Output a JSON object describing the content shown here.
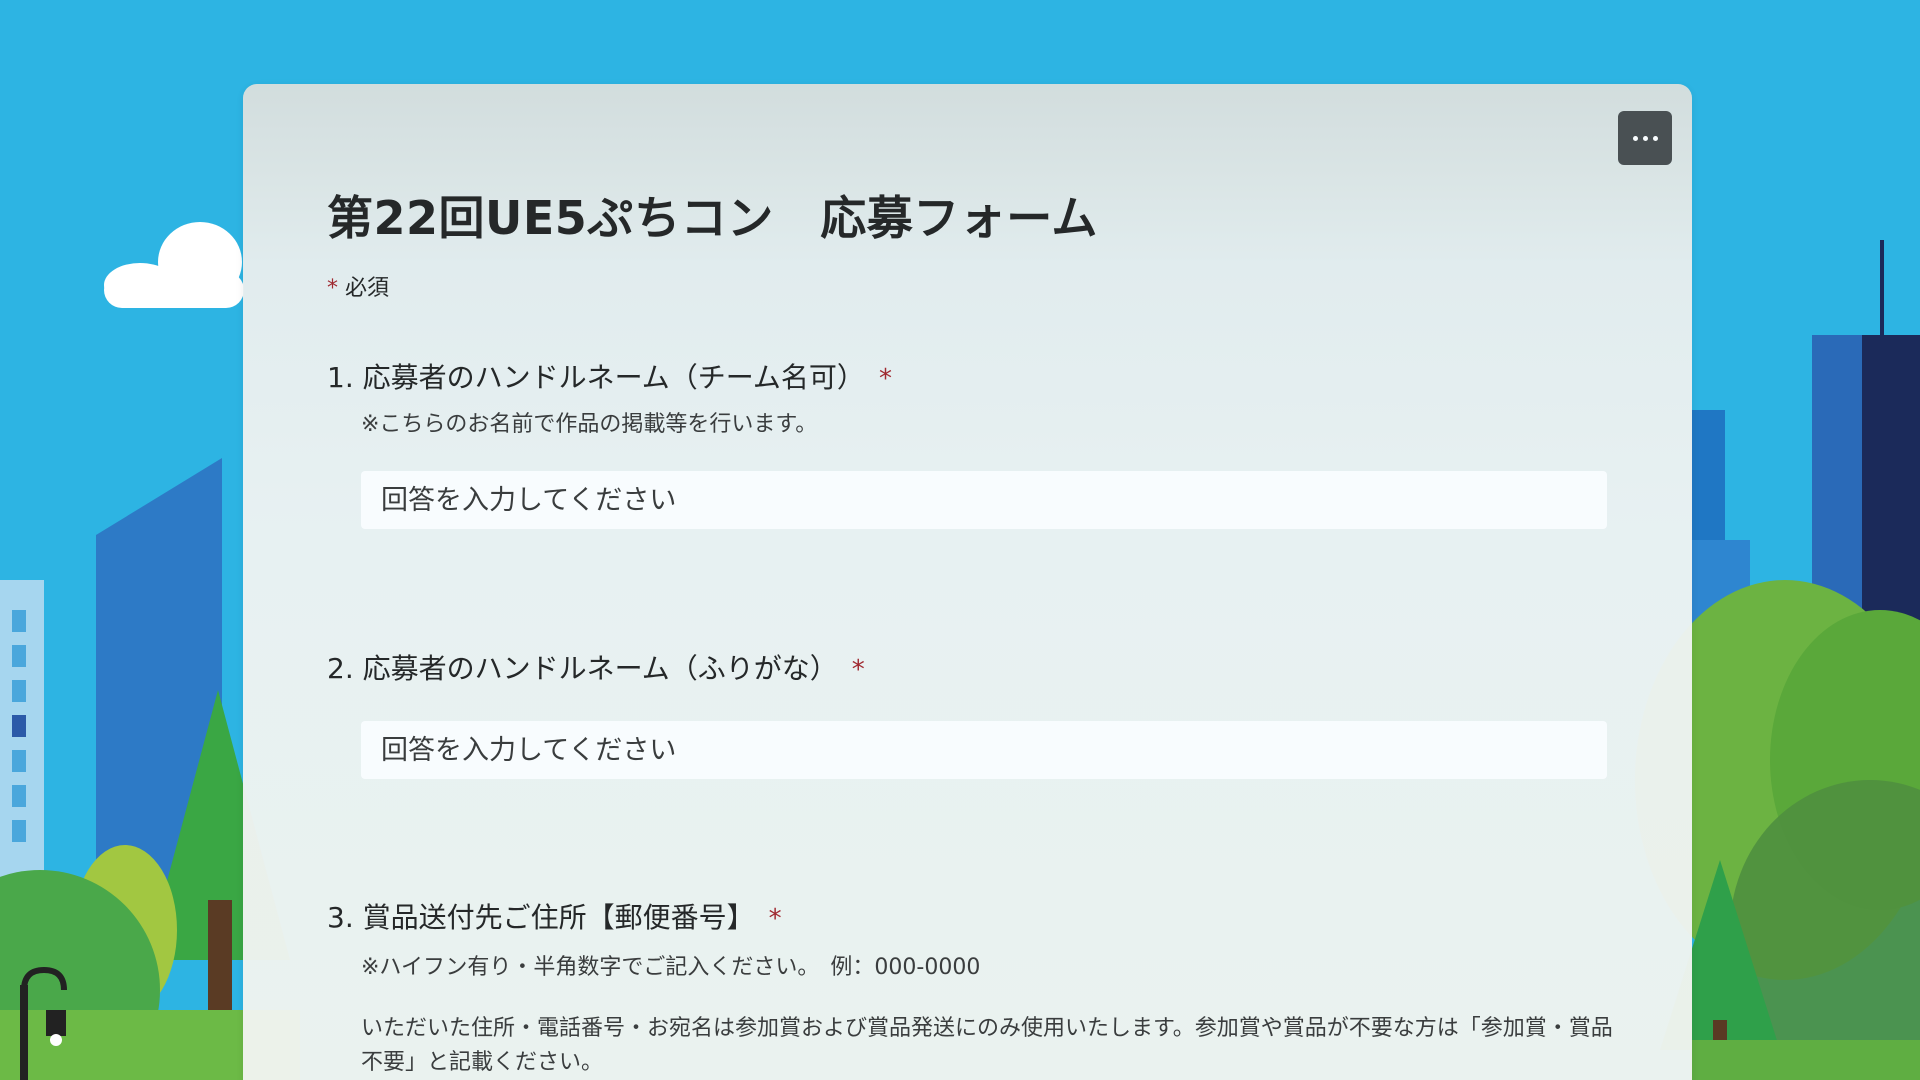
{
  "form": {
    "title": "第22回UE5ぷちコン　応募フォーム",
    "required_marker": "*",
    "required_label": "必須",
    "more_options_icon": "more-horizontal-icon"
  },
  "questions": [
    {
      "number_label": "1. 応募者のハンドルネーム（チーム名可）",
      "required": "*",
      "note": "※こちらのお名前で作品の掲載等を行います。",
      "placeholder": "回答を入力してください"
    },
    {
      "number_label": "2. 応募者のハンドルネーム（ふりがな）",
      "required": "*",
      "placeholder": "回答を入力してください"
    },
    {
      "number_label": "3. 賞品送付先ご住所【郵便番号】",
      "required": "*",
      "note": "※ハイフン有り・半角数字でご記入ください。　例：000-0000",
      "description": "いただいた住所・電話番号・お宛名は参加賞および賞品発送にのみ使用いたします。参加賞や賞品が不要な方は「参加賞・賞品不要」と記載ください。"
    }
  ],
  "theme": {
    "sky": "#2db4e3",
    "required_color": "#a4262c",
    "button_bg": "#4a4d4f"
  }
}
